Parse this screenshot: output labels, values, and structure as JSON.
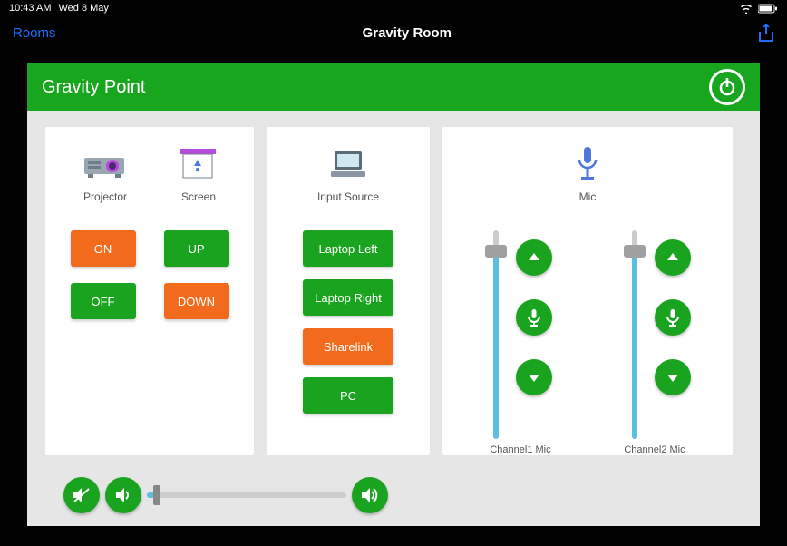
{
  "status": {
    "time": "10:43 AM",
    "date": "Wed 8 May"
  },
  "nav": {
    "back": "Rooms",
    "title": "Gravity Room"
  },
  "header": {
    "room": "Gravity Point"
  },
  "projector": {
    "label": "Projector",
    "on": "ON",
    "off": "OFF"
  },
  "screen": {
    "label": "Screen",
    "up": "UP",
    "down": "DOWN"
  },
  "input": {
    "label": "Input Source",
    "laptop_left": "Laptop Left",
    "laptop_right": "Laptop Right",
    "sharelink": "Sharelink",
    "pc": "PC"
  },
  "mic": {
    "label": "Mic",
    "ch1_label": "Channel1 Mic",
    "ch2_label": "Channel2 Mic",
    "ch1_level": 90,
    "ch2_level": 90
  },
  "volume": {
    "level": 5
  },
  "colors": {
    "green": "#1aa31f",
    "orange": "#f26a1b",
    "accent_blue": "#5abfe0"
  }
}
